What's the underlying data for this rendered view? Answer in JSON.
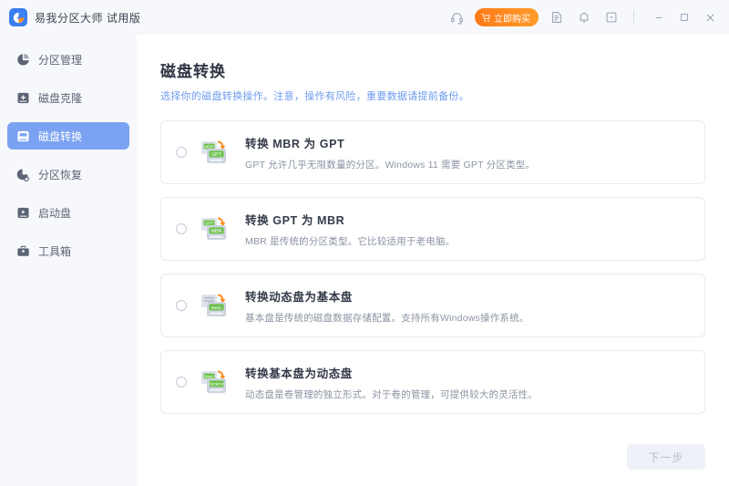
{
  "titlebar": {
    "app_name": "易我分区大师",
    "edition": "试用版",
    "logo_icon": "pie-logo-icon",
    "support_icon": "headset-icon",
    "buy_label": "立即购买",
    "buy_icon": "cart-icon",
    "buy_color": "#ff7a18",
    "feedback_icon": "document-icon",
    "notification_icon": "bell-icon",
    "more_icon": "box-dropdown-icon",
    "minimize_icon": "minimize-icon",
    "maximize_icon": "maximize-icon",
    "close_icon": "close-icon"
  },
  "sidebar": {
    "active_index": 2,
    "active_color": "#7ba2f2",
    "items": [
      {
        "label": "分区管理",
        "icon": "pie-chart-icon"
      },
      {
        "label": "磁盘克隆",
        "icon": "disk-plus-icon"
      },
      {
        "label": "磁盘转换",
        "icon": "disk-convert-icon"
      },
      {
        "label": "分区恢复",
        "icon": "pie-restore-icon"
      },
      {
        "label": "启动盘",
        "icon": "boot-disk-icon"
      },
      {
        "label": "工具箱",
        "icon": "toolbox-icon"
      }
    ]
  },
  "main": {
    "title": "磁盘转换",
    "subtitle": "选择你的磁盘转换操作。注意，操作有风险，重要数据请提前备份。",
    "subtitle_color": "#6f9cf0",
    "options": [
      {
        "title": "转换 MBR 为 GPT",
        "desc": "GPT 允许几乎无限数量的分区。Windows 11 需要 GPT 分区类型。",
        "icon": "disk-mbr-to-gpt-icon",
        "from_tag": "MBR",
        "to_tag": "GPT",
        "selected": false
      },
      {
        "title": "转换 GPT 为 MBR",
        "desc": "MBR 是传统的分区类型。它比较适用于老电脑。",
        "icon": "disk-gpt-to-mbr-icon",
        "from_tag": "GPT",
        "to_tag": "MBR",
        "selected": false
      },
      {
        "title": "转换动态盘为基本盘",
        "desc": "基本盘是传统的磁盘数据存储配置。支持所有Windows操作系统。",
        "icon": "disk-dynamic-to-basic-icon",
        "from_tag": "",
        "to_tag": "Basic",
        "selected": false
      },
      {
        "title": "转换基本盘为动态盘",
        "desc": "动态盘是卷管理的独立形式。对于卷的管理，可提供较大的灵活性。",
        "icon": "disk-basic-to-dynamic-icon",
        "from_tag": "Basic",
        "to_tag": "Dynamic",
        "selected": false
      }
    ],
    "next_label": "下一步",
    "next_enabled": false
  }
}
